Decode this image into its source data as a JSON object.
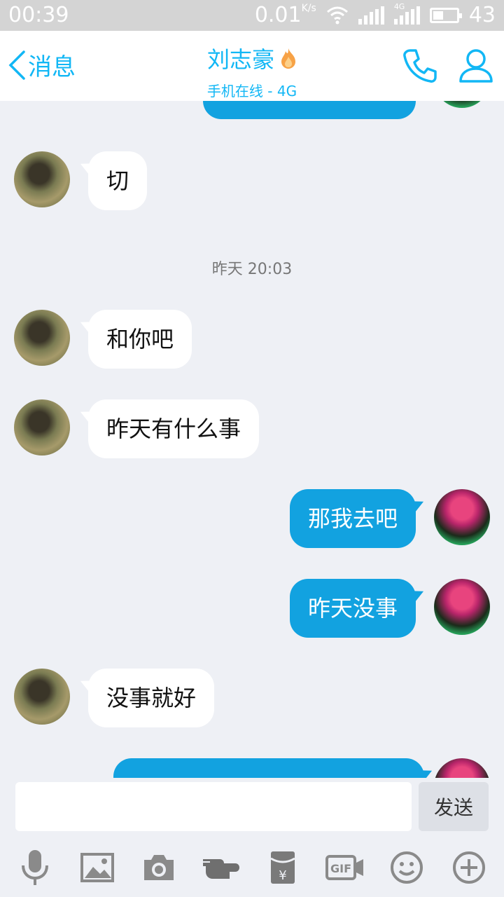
{
  "status_bar": {
    "time": "00:39",
    "speed": "0.01",
    "speed_unit": "K/s",
    "signal_label": "4G",
    "battery": "43"
  },
  "header": {
    "back_label": "消息",
    "contact_name": "刘志豪",
    "status": "手机在线 - 4G"
  },
  "messages": [
    {
      "dir": "in",
      "text": "切"
    },
    {
      "timestamp": "昨天 20:03"
    },
    {
      "dir": "in",
      "text": "和你吧"
    },
    {
      "dir": "in",
      "text": "昨天有什么事"
    },
    {
      "dir": "out",
      "text": "那我去吧"
    },
    {
      "dir": "out",
      "text": "昨天没事"
    },
    {
      "dir": "in",
      "text": "没事就好"
    }
  ],
  "input": {
    "value": "",
    "placeholder": ""
  },
  "send_label": "发送",
  "toolbar": [
    "microphone-icon",
    "image-icon",
    "camera-icon",
    "hand-icon",
    "red-packet-icon",
    "gif-icon",
    "emoji-icon",
    "plus-icon"
  ],
  "colors": {
    "accent": "#12b7f5",
    "outgoing_bubble": "#12a2e0",
    "background": "#eef0f5"
  }
}
